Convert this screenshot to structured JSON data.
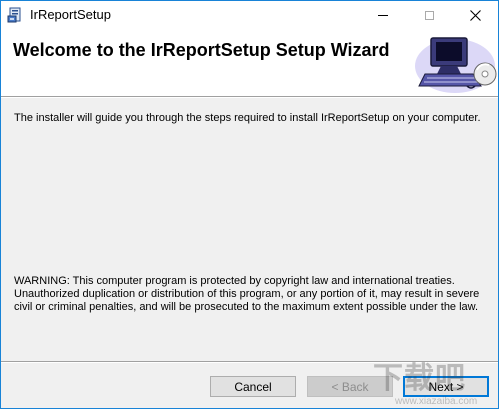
{
  "window": {
    "title": "IrReportSetup",
    "minimize_icon": "minimize-icon",
    "maximize_icon": "maximize-icon",
    "close_icon": "close-icon"
  },
  "header": {
    "title": "Welcome to the IrReportSetup Setup Wizard",
    "banner_icon": "computer-installer-icon"
  },
  "body": {
    "intro": "The installer will guide you through the steps required to install IrReportSetup on your computer.",
    "warning": "WARNING: This computer program is protected by copyright law and international treaties. Unauthorized duplication or distribution of this program, or any portion of it, may result in severe civil or criminal penalties, and will be prosecuted to the maximum extent possible under the law."
  },
  "buttons": {
    "cancel": "Cancel",
    "back": "< Back",
    "next": "Next >"
  },
  "watermark": {
    "logo": "下载吧",
    "url": "www.xiazaiba.com"
  },
  "colors": {
    "accent": "#0078d7",
    "window_border": "#1883d7",
    "background": "#f0f0f0"
  }
}
